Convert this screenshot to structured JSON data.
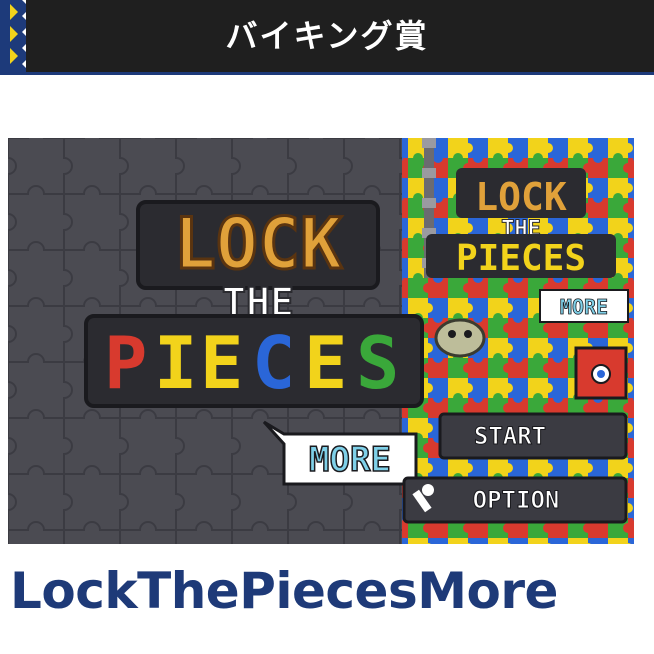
{
  "award": {
    "title": "バイキング賞"
  },
  "game": {
    "logo_line1": "LOCK",
    "logo_line2": "THE",
    "logo_line3": "PIECES",
    "more_badge": "MORE",
    "menu": {
      "start_label": "START",
      "option_label": "OPTION"
    },
    "mini_logo_line1": "LOCK",
    "mini_logo_line2": "THE",
    "mini_logo_line3": "PIECES",
    "mini_more_badge": "MORE"
  },
  "app": {
    "title": "LockThePiecesMore"
  },
  "colors": {
    "banner_bg": "#1f1f1f",
    "banner_accent": "#1d3a7a",
    "title_text": "#1e3a78",
    "piece_red": "#d83a2e",
    "piece_yellow": "#f2d31b",
    "piece_blue": "#2a66d8",
    "piece_green": "#3aa83a"
  }
}
